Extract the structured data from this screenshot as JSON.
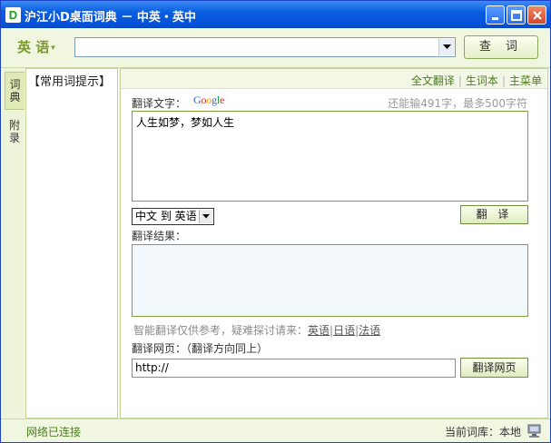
{
  "titlebar": {
    "logo": "D",
    "title": "沪江小D桌面词典 － 中英・英中"
  },
  "searchbar": {
    "language": "英 语",
    "query": "",
    "lookup_label": "查 词"
  },
  "vtabs": {
    "dictionary": "词典",
    "appendix": "附录"
  },
  "wordpanel": {
    "title": "【常用词提示】"
  },
  "topnav": {
    "full_translate": "全文翻译",
    "wordbook": "生词本",
    "main_menu": "主菜单"
  },
  "translate": {
    "source_label": "翻译文字：",
    "google_logo": "Google",
    "char_count": "还能输491字，最多500字符",
    "source_text": "人生如梦，梦如人生",
    "direction": "中文 到 英语",
    "translate_button": "翻 译",
    "result_label": "翻译结果：",
    "result_text": "",
    "hint_prefix": "智能翻译仅供参考，疑难探讨请来：",
    "hint_english": "英语",
    "hint_japanese": "日语",
    "hint_french": "法语",
    "webpage_label": "翻译网页：（翻译方向同上）",
    "url_value": "http://",
    "webpage_button": "翻译网页"
  },
  "statusbar": {
    "network": "网络已连接",
    "current_dict": "当前词库：本地"
  }
}
